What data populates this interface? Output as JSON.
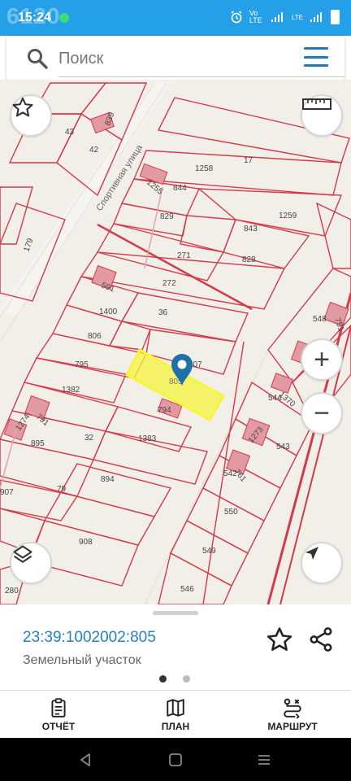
{
  "status_bar": {
    "watermark": "6120",
    "time": "15:24",
    "network": "Vo LTE",
    "lte_label": "LTE",
    "colors": {
      "background": "#25a0e8"
    }
  },
  "search": {
    "placeholder": "Поиск",
    "icon": "search-icon",
    "menu_icon": "hamburger-menu-icon"
  },
  "map": {
    "street_label": "Спортивная улица",
    "parcel_labels": [
      "43",
      "42",
      "839",
      "1255",
      "844",
      "1258",
      "17",
      "829",
      "843",
      "1259",
      "179",
      "271",
      "828",
      "591",
      "272",
      "1400",
      "36",
      "548",
      "751",
      "806",
      "795",
      "807",
      "805",
      "544",
      "1370",
      "1382",
      "794",
      "791",
      "1274",
      "32",
      "1383",
      "895",
      "1273",
      "543",
      "542",
      "761",
      "894",
      "907",
      "79",
      "550",
      "908",
      "549",
      "280",
      "546"
    ],
    "selected_parcel": "805",
    "highlight_color": "#f5f53c",
    "boundary_color": "#d33a4a",
    "controls": {
      "favorite": "star-icon",
      "measure": "ruler-icon",
      "zoom_in": "+",
      "zoom_out": "−",
      "layers": "layers-icon",
      "locate": "navigation-arrow-icon"
    }
  },
  "info_sheet": {
    "cadastral_number": "23:39:1002002:805",
    "object_type": "Земельный участок",
    "pages": 2,
    "active_page": 1
  },
  "bottom_nav": [
    {
      "label": "ОТЧЁТ",
      "icon": "report-icon"
    },
    {
      "label": "ПЛАН",
      "icon": "map-plan-icon"
    },
    {
      "label": "МАРШРУТ",
      "icon": "route-icon"
    }
  ]
}
